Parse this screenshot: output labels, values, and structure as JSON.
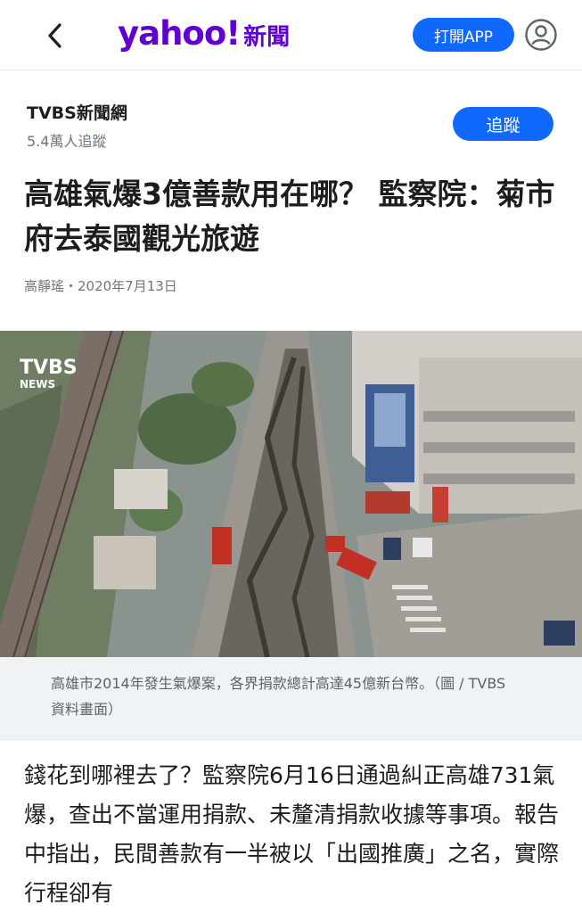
{
  "header": {
    "logo_text": "yahoo!",
    "section": "新聞",
    "open_app_label": "打開APP",
    "brand_color": "#6001d2",
    "accent_color": "#0f69ff",
    "icons": [
      "back-chevron-icon",
      "profile-icon"
    ]
  },
  "publisher": {
    "name": "TVBS新聞網",
    "followers": "5.4萬人追蹤",
    "follow_label": "追蹤"
  },
  "article": {
    "headline": "高雄氣爆3億善款用在哪？ 監察院：菊市府去泰國觀光旅遊",
    "byline": "高靜瑤・2020年7月13日",
    "image_watermark_line1": "TVBS",
    "image_watermark_line2": "NEWS",
    "caption": "高雄市2014年發生氣爆案，各界捐款總計高達45億新台幣。（圖 / TVBS資料畫面）",
    "body": "錢花到哪裡去了？監察院6月16日通過糾正高雄731氣爆，查出不當運用捐款、未釐清捐款收據等事項。報告中指出，民間善款有一半被以「出國推廣」之名，實際行程卻有"
  }
}
